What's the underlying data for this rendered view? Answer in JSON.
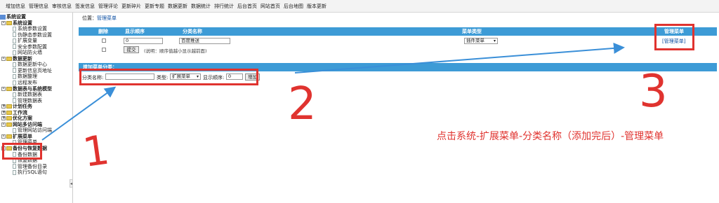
{
  "topnav": [
    "增加信息",
    "管理信息",
    "审核信息",
    "签发信息",
    "管理评论",
    "更新碎片",
    "更新专题",
    "数据更新",
    "数据统计",
    "排行统计",
    "后台首页",
    "网站首页",
    "后台地图",
    "版本更新"
  ],
  "sidebar": {
    "collapse_glyph": "◂",
    "items": [
      {
        "label": "系统设置",
        "level": 0
      },
      {
        "label": "系统设置",
        "level": 1,
        "expander": "-"
      },
      {
        "label": "系统参数设置",
        "level": 2
      },
      {
        "label": "伪静态参数设置",
        "level": 2
      },
      {
        "label": "扩展变量",
        "level": 2
      },
      {
        "label": "安全参数配置",
        "level": 2
      },
      {
        "label": "网站防火墙",
        "level": 2
      },
      {
        "label": "数据更新",
        "level": 1,
        "expander": "-"
      },
      {
        "label": "数据更新中心",
        "level": 2
      },
      {
        "label": "更新信息页地址",
        "level": 2
      },
      {
        "label": "数据整理",
        "level": 2
      },
      {
        "label": "远程发布",
        "level": 2
      },
      {
        "label": "数据表与系统模型",
        "level": 1,
        "expander": "-"
      },
      {
        "label": "新建数据表",
        "level": 2
      },
      {
        "label": "管理数据表",
        "level": 2
      },
      {
        "label": "计划任务",
        "level": 1,
        "expander": "+"
      },
      {
        "label": "工作流",
        "level": 1,
        "expander": "+"
      },
      {
        "label": "优化方案",
        "level": 1,
        "expander": "+"
      },
      {
        "label": "网站多访问端",
        "level": 1,
        "expander": "-"
      },
      {
        "label": "管理网站访问端",
        "level": 2
      },
      {
        "label": "扩展菜单",
        "level": 1,
        "expander": "-"
      },
      {
        "label": "管理菜单",
        "level": 2
      },
      {
        "label": "备份与恢复数据",
        "level": 1,
        "expander": "-"
      },
      {
        "label": "备份数据",
        "level": 2
      },
      {
        "label": "恢复数据",
        "level": 2
      },
      {
        "label": "管理备份目录",
        "level": 2
      },
      {
        "label": "执行SQL语句",
        "level": 2
      }
    ]
  },
  "breadcrumb": {
    "prefix": "位置：",
    "link": "管理菜单"
  },
  "table": {
    "headers": [
      "删除",
      "显示顺序",
      "分类名称",
      "菜单类型",
      "管理菜单"
    ],
    "row": {
      "order": "0",
      "name": "百度推送",
      "type": "插件菜单",
      "manage_link": "[管理菜单]"
    },
    "submit_label": "提交",
    "note": "(说明：顺序值越小显示越前面)"
  },
  "add_section": {
    "title": "增加菜单分类：",
    "name_label": "分类名称:",
    "name_value": "",
    "type_label": "类型:",
    "type_value": "扩展菜单",
    "order_label": "显示顺序:",
    "order_value": "0",
    "add_label": "增加"
  },
  "annotations": {
    "num1": "1",
    "num2": "2",
    "num3": "3",
    "instruction": "点击系统-扩展菜单-分类名称（添加完后）-管理菜单",
    "color": "#e0332f",
    "arrow_color": "#3a8fd8"
  }
}
